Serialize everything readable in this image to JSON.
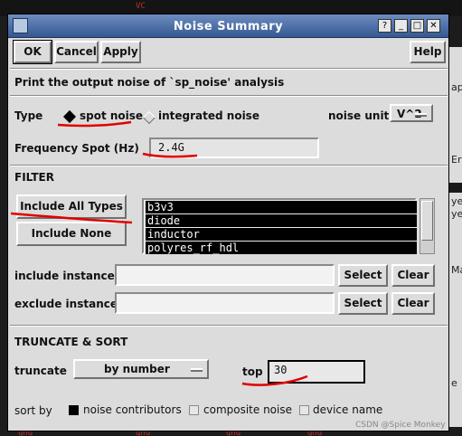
{
  "background": {
    "top_left_text": "VC",
    "right_window_items": [
      "ap",
      "Er",
      "ye",
      "ye",
      "ye",
      "Ma",
      "e"
    ],
    "bottom_labels": [
      "gnd",
      "gnd",
      "gnd",
      "gnd",
      "gnd"
    ]
  },
  "window": {
    "title": "Noise Summary",
    "controls": [
      "?",
      "_",
      "□",
      "✕"
    ]
  },
  "toolbar": {
    "ok_label": "OK",
    "cancel_label": "Cancel",
    "apply_label": "Apply",
    "help_label": "Help"
  },
  "description": "Print the output noise of `sp_noise' analysis",
  "type": {
    "label": "Type",
    "option_spot": "spot noise",
    "option_integrated": "integrated noise",
    "selected": "spot noise",
    "noise_unit_label": "noise unit",
    "noise_unit_value": "V^2"
  },
  "frequency": {
    "label": "Frequency Spot (Hz)",
    "value": "2.4G"
  },
  "filter": {
    "heading": "FILTER",
    "include_all_label": "Include All Types",
    "include_none_label": "Include None",
    "types": [
      "b3v3",
      "diode",
      "inductor",
      "polyres_rf_hdl"
    ],
    "include_instances_label": "include instances",
    "exclude_instances_label": "exclude instances",
    "include_instances_value": "",
    "exclude_instances_value": "",
    "select_label": "Select",
    "clear_label": "Clear"
  },
  "truncate": {
    "heading": "TRUNCATE & SORT",
    "truncate_label": "truncate",
    "truncate_value": "by number",
    "top_label": "top",
    "top_value": "30",
    "sort_by_label": "sort by",
    "sort_options": [
      "noise contributors",
      "composite noise",
      "device name"
    ],
    "sort_selected": "noise contributors"
  },
  "watermark": "CSDN @Spice Monkey",
  "colors": {
    "titlebar": "#345891",
    "window_bg": "#dcdcdc",
    "annotation": "#e00000"
  }
}
